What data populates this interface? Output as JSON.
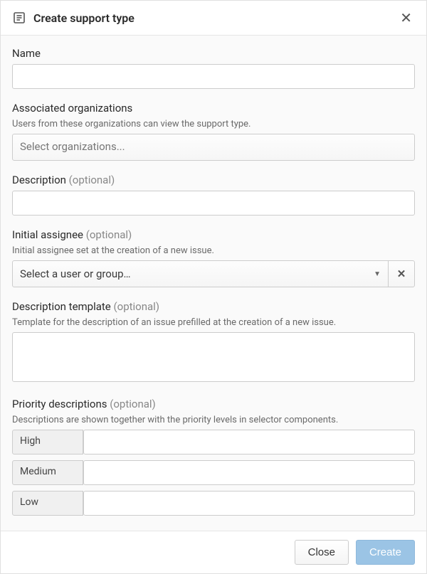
{
  "header": {
    "title": "Create support type"
  },
  "fields": {
    "name": {
      "label": "Name"
    },
    "orgs": {
      "label": "Associated organizations",
      "hint": "Users from these organizations can view the support type.",
      "placeholder": "Select organizations..."
    },
    "description": {
      "label": "Description",
      "optional": "(optional)"
    },
    "assignee": {
      "label": "Initial assignee",
      "optional": "(optional)",
      "hint": "Initial assignee set at the creation of a new issue.",
      "placeholder": "Select a user or group…"
    },
    "template": {
      "label": "Description template",
      "optional": "(optional)",
      "hint": "Template for the description of an issue prefilled at the creation of a new issue."
    },
    "priority": {
      "label": "Priority descriptions",
      "optional": "(optional)",
      "hint": "Descriptions are shown together with the priority levels in selector components.",
      "levels": {
        "high": "High",
        "medium": "Medium",
        "low": "Low"
      }
    }
  },
  "footer": {
    "close": "Close",
    "create": "Create"
  }
}
